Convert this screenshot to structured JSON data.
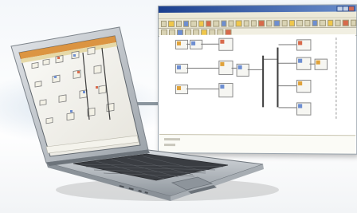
{
  "scene": {
    "description_free": true,
    "colors": {
      "titlebar": "#1b3f8e",
      "chrome": "#ece9d8",
      "laptop_body": "#c9cdd2",
      "keyboard": "#3a3d42",
      "accent_line": "#8a959e",
      "laptop_screen_header": "#d8892f"
    }
  },
  "app_window": {
    "icons": [
      "window-minimize-icon",
      "window-maximize-icon",
      "window-close-icon"
    ]
  },
  "laptop": {
    "icons": [
      "touchpad",
      "keyboard"
    ]
  }
}
